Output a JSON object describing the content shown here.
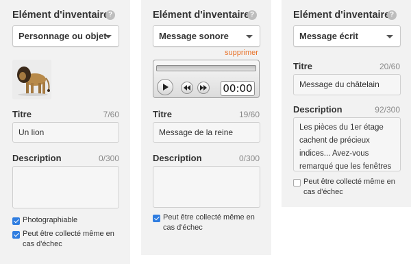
{
  "panels": [
    {
      "heading": "Elément d'inventaire",
      "help": "?",
      "type_value": "Personnage ou objet",
      "title_label": "Titre",
      "title_count": "7/60",
      "title_value": "Un lion",
      "description_label": "Description",
      "description_count": "0/300",
      "description_value": "",
      "checkboxes": [
        {
          "label": "Photographiable",
          "checked": true
        },
        {
          "label": "Peut être collecté même en cas d'échec",
          "checked": true
        }
      ]
    },
    {
      "heading": "Elément d'inventaire",
      "help": "?",
      "type_value": "Message sonore",
      "delete_link": "supprimer",
      "player_time": "00:00",
      "title_label": "Titre",
      "title_count": "19/60",
      "title_value": "Message de la reine",
      "description_label": "Description",
      "description_count": "0/300",
      "description_value": "",
      "checkboxes": [
        {
          "label": "Peut être collecté même en cas d'échec",
          "checked": true
        }
      ]
    },
    {
      "heading": "Elément d'inventaire",
      "help": "?",
      "type_value": "Message écrit",
      "title_label": "Titre",
      "title_count": "20/60",
      "title_value": "Message du châtelain",
      "description_label": "Description",
      "description_count": "92/300",
      "description_value": "Les pièces du 1er étage cachent de précieux indices... Avez-vous remarqué que les fenêtres",
      "checkboxes": [
        {
          "label": "Peut être collecté même en cas d'échec",
          "checked": false
        }
      ]
    }
  ],
  "icons": {
    "lion_image": "lion-thumbnail",
    "play": "play-icon",
    "rewind": "rewind-icon",
    "forward": "fast-forward-icon"
  },
  "colors": {
    "panel_bg": "#f2f2f2",
    "checkbox": "#2f7de0",
    "delete_link": "#e8732a"
  }
}
